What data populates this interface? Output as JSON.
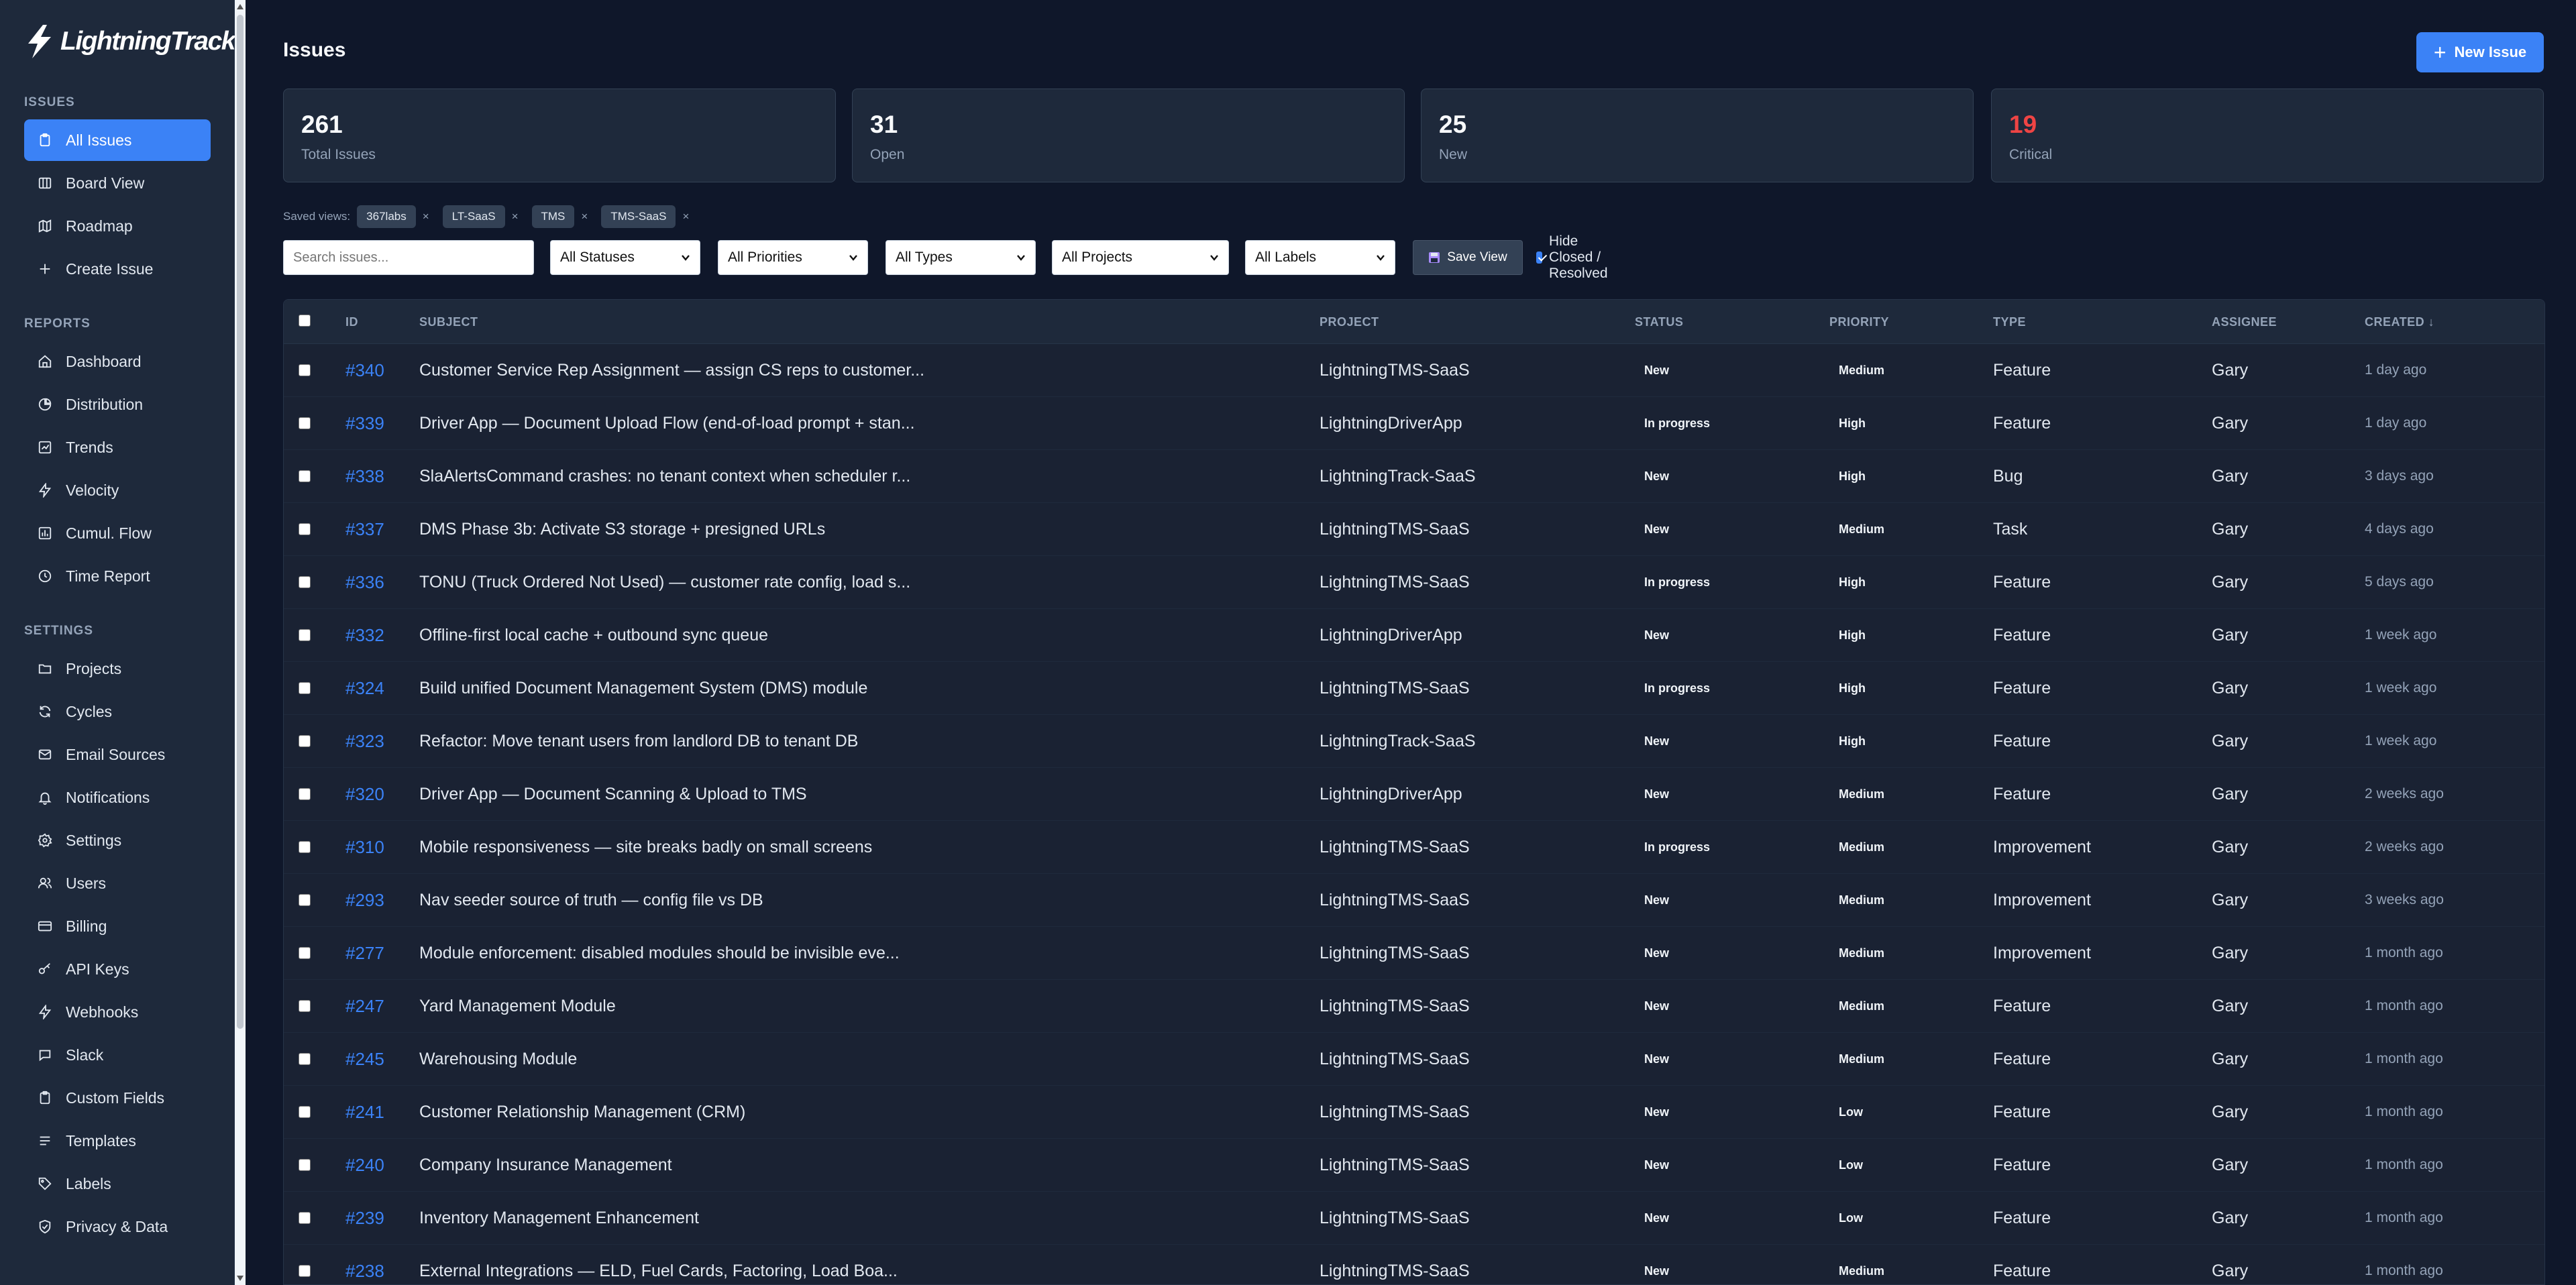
{
  "app": {
    "name": "LightningTrack"
  },
  "sidebar": {
    "sections": [
      {
        "label": "ISSUES"
      },
      {
        "label": "REPORTS"
      },
      {
        "label": "SETTINGS"
      }
    ],
    "items": [
      {
        "label": "All Issues",
        "icon": "clipboard-icon",
        "active": true
      },
      {
        "label": "Board View",
        "icon": "board-icon"
      },
      {
        "label": "Roadmap",
        "icon": "map-icon"
      },
      {
        "label": "Create Issue",
        "icon": "plus-icon"
      },
      {
        "label": "Dashboard",
        "icon": "home-icon"
      },
      {
        "label": "Distribution",
        "icon": "pie-chart-icon"
      },
      {
        "label": "Trends",
        "icon": "trend-icon"
      },
      {
        "label": "Velocity",
        "icon": "lightning-icon"
      },
      {
        "label": "Cumul. Flow",
        "icon": "bar-chart-icon"
      },
      {
        "label": "Time Report",
        "icon": "clock-icon"
      },
      {
        "label": "Projects",
        "icon": "folder-icon"
      },
      {
        "label": "Cycles",
        "icon": "refresh-icon"
      },
      {
        "label": "Email Sources",
        "icon": "mail-icon"
      },
      {
        "label": "Notifications",
        "icon": "bell-icon"
      },
      {
        "label": "Settings",
        "icon": "gear-icon"
      },
      {
        "label": "Users",
        "icon": "users-icon"
      },
      {
        "label": "Billing",
        "icon": "credit-card-icon"
      },
      {
        "label": "API Keys",
        "icon": "key-icon"
      },
      {
        "label": "Webhooks",
        "icon": "lightning-icon"
      },
      {
        "label": "Slack",
        "icon": "chat-icon"
      },
      {
        "label": "Custom Fields",
        "icon": "clipboard-icon"
      },
      {
        "label": "Templates",
        "icon": "lines-icon"
      },
      {
        "label": "Labels",
        "icon": "tag-icon"
      },
      {
        "label": "Privacy & Data",
        "icon": "shield-icon"
      }
    ]
  },
  "header": {
    "title": "Issues",
    "new_issue_label": "New Issue"
  },
  "stats": [
    {
      "value": "261",
      "label": "Total Issues"
    },
    {
      "value": "31",
      "label": "Open"
    },
    {
      "value": "25",
      "label": "New"
    },
    {
      "value": "19",
      "label": "Critical"
    }
  ],
  "saved_views": {
    "label": "Saved views:",
    "chips": [
      "367labs",
      "LT-SaaS",
      "TMS",
      "TMS-SaaS"
    ],
    "remove_glyph": "×"
  },
  "filters": {
    "search_placeholder": "Search issues...",
    "selects": [
      "All Statuses",
      "All Priorities",
      "All Types",
      "All Projects",
      "All Labels"
    ],
    "save_view_label": "Save View",
    "hide_closed_label": "Hide Closed / Resolved",
    "hide_closed_checked": true
  },
  "table": {
    "columns": [
      "ID",
      "SUBJECT",
      "PROJECT",
      "STATUS",
      "PRIORITY",
      "TYPE",
      "ASSIGNEE",
      "CREATED ↓"
    ],
    "rows": [
      {
        "id": "#340",
        "subject": "Customer Service Rep Assignment — assign CS reps to customer...",
        "project": "LightningTMS-SaaS",
        "status": "New",
        "priority": "Medium",
        "type": "Feature",
        "assignee": "Gary",
        "created": "1 day ago"
      },
      {
        "id": "#339",
        "subject": "Driver App — Document Upload Flow (end-of-load prompt + stan...",
        "project": "LightningDriverApp",
        "status": "In progress",
        "priority": "High",
        "type": "Feature",
        "assignee": "Gary",
        "created": "1 day ago"
      },
      {
        "id": "#338",
        "subject": "SlaAlertsCommand crashes: no tenant context when scheduler r...",
        "project": "LightningTrack-SaaS",
        "status": "New",
        "priority": "High",
        "type": "Bug",
        "assignee": "Gary",
        "created": "3 days ago"
      },
      {
        "id": "#337",
        "subject": "DMS Phase 3b: Activate S3 storage + presigned URLs",
        "project": "LightningTMS-SaaS",
        "status": "New",
        "priority": "Medium",
        "type": "Task",
        "assignee": "Gary",
        "created": "4 days ago"
      },
      {
        "id": "#336",
        "subject": "TONU (Truck Ordered Not Used) — customer rate config, load s...",
        "project": "LightningTMS-SaaS",
        "status": "In progress",
        "priority": "High",
        "type": "Feature",
        "assignee": "Gary",
        "created": "5 days ago"
      },
      {
        "id": "#332",
        "subject": "Offline-first local cache + outbound sync queue",
        "project": "LightningDriverApp",
        "status": "New",
        "priority": "High",
        "type": "Feature",
        "assignee": "Gary",
        "created": "1 week ago"
      },
      {
        "id": "#324",
        "subject": "Build unified Document Management System (DMS) module",
        "project": "LightningTMS-SaaS",
        "status": "In progress",
        "priority": "High",
        "type": "Feature",
        "assignee": "Gary",
        "created": "1 week ago"
      },
      {
        "id": "#323",
        "subject": "Refactor: Move tenant users from landlord DB to tenant DB",
        "project": "LightningTrack-SaaS",
        "status": "New",
        "priority": "High",
        "type": "Feature",
        "assignee": "Gary",
        "created": "1 week ago"
      },
      {
        "id": "#320",
        "subject": "Driver App — Document Scanning & Upload to TMS",
        "project": "LightningDriverApp",
        "status": "New",
        "priority": "Medium",
        "type": "Feature",
        "assignee": "Gary",
        "created": "2 weeks ago"
      },
      {
        "id": "#310",
        "subject": "Mobile responsiveness — site breaks badly on small screens",
        "project": "LightningTMS-SaaS",
        "status": "In progress",
        "priority": "Medium",
        "type": "Improvement",
        "assignee": "Gary",
        "created": "2 weeks ago"
      },
      {
        "id": "#293",
        "subject": "Nav seeder source of truth — config file vs DB",
        "project": "LightningTMS-SaaS",
        "status": "New",
        "priority": "Medium",
        "type": "Improvement",
        "assignee": "Gary",
        "created": "3 weeks ago"
      },
      {
        "id": "#277",
        "subject": "Module enforcement: disabled modules should be invisible eve...",
        "project": "LightningTMS-SaaS",
        "status": "New",
        "priority": "Medium",
        "type": "Improvement",
        "assignee": "Gary",
        "created": "1 month ago"
      },
      {
        "id": "#247",
        "subject": "Yard Management Module",
        "project": "LightningTMS-SaaS",
        "status": "New",
        "priority": "Medium",
        "type": "Feature",
        "assignee": "Gary",
        "created": "1 month ago"
      },
      {
        "id": "#245",
        "subject": "Warehousing Module",
        "project": "LightningTMS-SaaS",
        "status": "New",
        "priority": "Medium",
        "type": "Feature",
        "assignee": "Gary",
        "created": "1 month ago"
      },
      {
        "id": "#241",
        "subject": "Customer Relationship Management (CRM)",
        "project": "LightningTMS-SaaS",
        "status": "New",
        "priority": "Low",
        "type": "Feature",
        "assignee": "Gary",
        "created": "1 month ago"
      },
      {
        "id": "#240",
        "subject": "Company Insurance Management",
        "project": "LightningTMS-SaaS",
        "status": "New",
        "priority": "Low",
        "type": "Feature",
        "assignee": "Gary",
        "created": "1 month ago"
      },
      {
        "id": "#239",
        "subject": "Inventory Management Enhancement",
        "project": "LightningTMS-SaaS",
        "status": "New",
        "priority": "Low",
        "type": "Feature",
        "assignee": "Gary",
        "created": "1 month ago"
      },
      {
        "id": "#238",
        "subject": "External Integrations — ELD, Fuel Cards, Factoring, Load Boa...",
        "project": "LightningTMS-SaaS",
        "status": "New",
        "priority": "Medium",
        "type": "Feature",
        "assignee": "Gary",
        "created": "1 month ago"
      }
    ]
  },
  "colors": {
    "accent": "#3b82f6",
    "critical": "#ef4444",
    "sidebar_bg": "#1e293b",
    "page_bg": "#0f172a"
  }
}
